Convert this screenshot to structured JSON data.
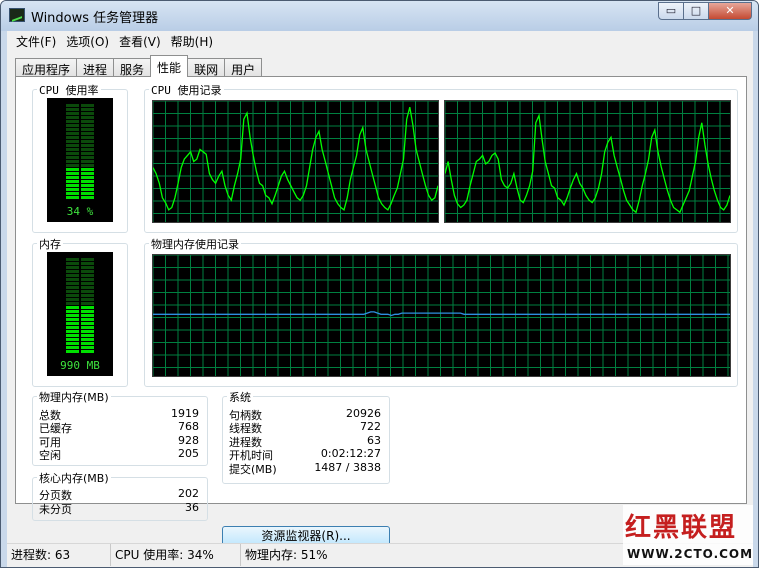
{
  "window": {
    "title": "Windows 任务管理器",
    "minimize_glyph": "▭",
    "maximize_glyph": "□",
    "close_glyph": "✕"
  },
  "menu": [
    "文件(F)",
    "选项(O)",
    "查看(V)",
    "帮助(H)"
  ],
  "tabs": [
    {
      "label": "应用程序"
    },
    {
      "label": "进程"
    },
    {
      "label": "服务"
    },
    {
      "label": "性能",
      "active": true
    },
    {
      "label": "联网"
    },
    {
      "label": "用户"
    }
  ],
  "cpu_usage": {
    "label": "CPU 使用率",
    "value_text": "34 %",
    "percent": 34
  },
  "cpu_history": {
    "label": "CPU 使用记录"
  },
  "memory": {
    "label": "内存",
    "value_text": "990 MB",
    "percent": 51
  },
  "memory_history": {
    "label": "物理内存使用记录"
  },
  "physical_memory": {
    "label": "物理内存(MB)",
    "rows": [
      {
        "name": "总数",
        "value": "1919"
      },
      {
        "name": "已缓存",
        "value": "768"
      },
      {
        "name": "可用",
        "value": "928"
      },
      {
        "name": "空闲",
        "value": "205"
      }
    ]
  },
  "kernel_memory": {
    "label": "核心内存(MB)",
    "rows": [
      {
        "name": "分页数",
        "value": "202"
      },
      {
        "name": "未分页",
        "value": "36"
      }
    ]
  },
  "system": {
    "label": "系统",
    "rows": [
      {
        "name": "句柄数",
        "value": "20926"
      },
      {
        "name": "线程数",
        "value": "722"
      },
      {
        "name": "进程数",
        "value": "63"
      },
      {
        "name": "开机时间",
        "value": "0:02:12:27"
      },
      {
        "name": "提交(MB)",
        "value": "1487 / 3838"
      }
    ]
  },
  "resource_monitor_button": "资源监视器(R)...",
  "status": {
    "processes": "进程数: 63",
    "cpu": "CPU 使用率: 34%",
    "memory": "物理内存: 51%"
  },
  "watermark": {
    "title": "红黑联盟",
    "url": "WWW.2CTO.COM"
  },
  "colors": {
    "grid": "#008040",
    "cpu_line": "#00ff00",
    "mem_line": "#2e8fe0",
    "meter_on": "#00e000",
    "meter_off": "#0b4a0b"
  },
  "series": {
    "cpu_core_1": [
      45,
      40,
      32,
      20,
      16,
      10,
      12,
      20,
      32,
      45,
      52,
      55,
      58,
      50,
      52,
      60,
      58,
      56,
      40,
      35,
      32,
      38,
      42,
      30,
      22,
      18,
      30,
      40,
      52,
      85,
      90,
      70,
      55,
      42,
      32,
      30,
      22,
      20,
      15,
      22,
      30,
      38,
      42,
      35,
      30,
      25,
      20,
      18,
      22,
      30,
      45,
      60,
      70,
      75,
      60,
      50,
      40,
      30,
      20,
      15,
      12,
      10,
      20,
      35,
      45,
      55,
      72,
      78,
      60,
      50,
      40,
      30,
      20,
      15,
      12,
      10,
      15,
      22,
      28,
      40,
      52,
      85,
      95,
      80,
      60,
      50,
      40,
      30,
      22,
      18,
      20,
      30
    ],
    "cpu_core_2": [
      40,
      50,
      35,
      22,
      15,
      12,
      14,
      18,
      30,
      40,
      50,
      52,
      55,
      48,
      50,
      55,
      57,
      52,
      35,
      30,
      28,
      32,
      40,
      28,
      18,
      16,
      22,
      30,
      42,
      82,
      88,
      68,
      50,
      40,
      30,
      28,
      20,
      18,
      14,
      20,
      28,
      35,
      40,
      32,
      28,
      22,
      18,
      16,
      20,
      28,
      40,
      58,
      66,
      70,
      55,
      45,
      36,
      26,
      18,
      14,
      10,
      8,
      18,
      30,
      40,
      52,
      70,
      76,
      58,
      46,
      36,
      26,
      18,
      12,
      10,
      8,
      14,
      20,
      26,
      38,
      50,
      70,
      82,
      64,
      48,
      36,
      26,
      18,
      12,
      10,
      14,
      22
    ],
    "memory_history": [
      51,
      51,
      51,
      51,
      51,
      51,
      51,
      51,
      51,
      51,
      51,
      51,
      51,
      51,
      51,
      51,
      51,
      51,
      51,
      51,
      51,
      51,
      51,
      51,
      51,
      51,
      51,
      51,
      51,
      51,
      51,
      51,
      51,
      51,
      51,
      51,
      51,
      51,
      51,
      51,
      51,
      51,
      51,
      51,
      51,
      51,
      51,
      51,
      51,
      51,
      51,
      51,
      51,
      51,
      51,
      51,
      51,
      51,
      51,
      51,
      51,
      51,
      52,
      53,
      53,
      52,
      51,
      51,
      51,
      50,
      51,
      51,
      52,
      52,
      52,
      52,
      52,
      52,
      52,
      52,
      52,
      52,
      52,
      52,
      52,
      52,
      52,
      52,
      52,
      52,
      51,
      51,
      51,
      51,
      51,
      51,
      51,
      51,
      51,
      51,
      51,
      51,
      51,
      51,
      51,
      51,
      51,
      51,
      51,
      51,
      51,
      51,
      51,
      51,
      51,
      51,
      51,
      51,
      51,
      51,
      51,
      51,
      51,
      51,
      51,
      51,
      51,
      51,
      51,
      51,
      51,
      51,
      51,
      51,
      51,
      51,
      51,
      51,
      51,
      51,
      51,
      51,
      51,
      51,
      51,
      51,
      51,
      51,
      51,
      51,
      51,
      51,
      51,
      51,
      51,
      51,
      51,
      51,
      51,
      51,
      51,
      51,
      51,
      51,
      51,
      51,
      51,
      51
    ]
  }
}
